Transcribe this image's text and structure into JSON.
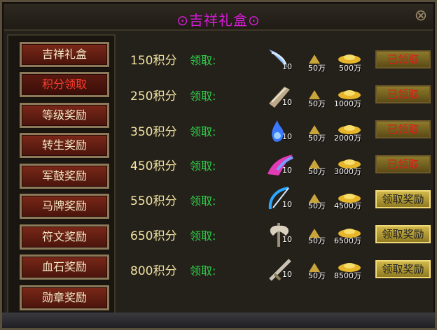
{
  "window": {
    "title": "⊙吉祥礼盒⊙",
    "close_glyph": "⊗"
  },
  "sidebar": {
    "items": [
      {
        "label": "吉祥礼盒",
        "active": false
      },
      {
        "label": "积分领取",
        "active": true
      },
      {
        "label": "等级奖励",
        "active": false
      },
      {
        "label": "转生奖励",
        "active": false
      },
      {
        "label": "军鼓奖励",
        "active": false
      },
      {
        "label": "马牌奖励",
        "active": false
      },
      {
        "label": "符文奖励",
        "active": false
      },
      {
        "label": "血石奖励",
        "active": false
      },
      {
        "label": "勋章奖励",
        "active": false
      }
    ]
  },
  "rewards": [
    {
      "points": "150积分",
      "claim_label": "领取:",
      "item_icon": "wing-icon",
      "item_qty": "10",
      "pile_amount": "50万",
      "coin_amount": "500万",
      "button": "已领取",
      "claimed": true
    },
    {
      "points": "250积分",
      "claim_label": "领取:",
      "item_icon": "wing-icon",
      "item_qty": "10",
      "pile_amount": "50万",
      "coin_amount": "1000万",
      "button": "已领取",
      "claimed": true
    },
    {
      "points": "350积分",
      "claim_label": "领取:",
      "item_icon": "blue-flame-icon",
      "item_qty": "10",
      "pile_amount": "50万",
      "coin_amount": "2000万",
      "button": "已领取",
      "claimed": true
    },
    {
      "points": "450积分",
      "claim_label": "领取:",
      "item_icon": "pink-wing-icon",
      "item_qty": "10",
      "pile_amount": "50万",
      "coin_amount": "3000万",
      "button": "已领取",
      "claimed": true
    },
    {
      "points": "550积分",
      "claim_label": "领取:",
      "item_icon": "bow-icon",
      "item_qty": "10",
      "pile_amount": "50万",
      "coin_amount": "4500万",
      "button": "领取奖励",
      "claimed": false
    },
    {
      "points": "650积分",
      "claim_label": "领取:",
      "item_icon": "axe-icon",
      "item_qty": "10",
      "pile_amount": "50万",
      "coin_amount": "6500万",
      "button": "领取奖励",
      "claimed": false
    },
    {
      "points": "800积分",
      "claim_label": "领取:",
      "item_icon": "sword-icon",
      "item_qty": "10",
      "pile_amount": "50万",
      "coin_amount": "8500万",
      "button": "领取奖励",
      "claimed": false
    }
  ],
  "colors": {
    "title": "#d61cd6",
    "claimed_text": "#e01818",
    "claim_label": "#2fd24a",
    "points": "#f1e2a0"
  }
}
